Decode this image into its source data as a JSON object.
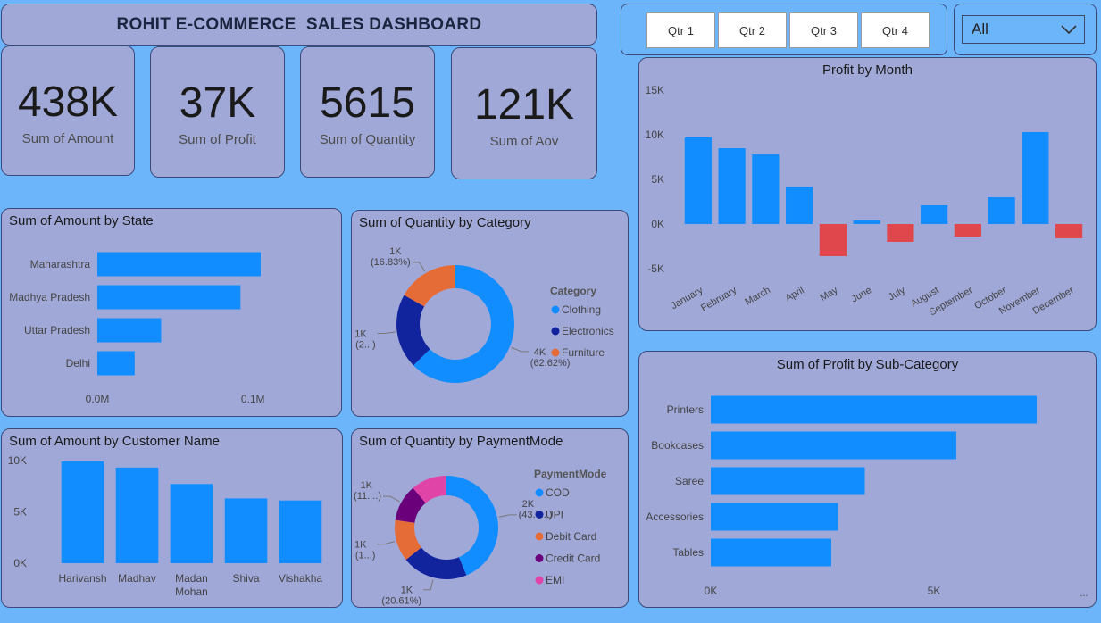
{
  "header": {
    "title": "ROHIT E-COMMERCE  SALES DASHBOARD"
  },
  "kpis": [
    {
      "value": "438K",
      "label": "Sum of Amount"
    },
    {
      "value": "37K",
      "label": "Sum of Profit"
    },
    {
      "value": "5615",
      "label": "Sum of Quantity"
    },
    {
      "value": "121K",
      "label": "Sum of Aov"
    }
  ],
  "quarter_slicer": [
    "Qtr 1",
    "Qtr 2",
    "Qtr 3",
    "Qtr 4"
  ],
  "dropdown": {
    "selected": "All"
  },
  "colors": {
    "positive": "#118dff",
    "negative": "#e0474c",
    "card": "#a0a8d8",
    "background": "#6db5fb"
  },
  "chart_data": [
    {
      "id": "amount_by_state",
      "type": "bar",
      "orientation": "horizontal",
      "title": "Sum of Amount by State",
      "categories": [
        "Maharashtra",
        "Madhya Pradesh",
        "Uttar Pradesh",
        "Delhi"
      ],
      "values": [
        105000,
        92000,
        41000,
        24000
      ],
      "xlim": [
        0,
        112500
      ],
      "xticks": [
        {
          "value": 0,
          "label": "0.0M"
        },
        {
          "value": 100000,
          "label": "0.1M"
        }
      ]
    },
    {
      "id": "quantity_by_category",
      "type": "pie",
      "donut": true,
      "title": "Sum of Quantity by Category",
      "legend_title": "Category",
      "labels": [
        "Clothing",
        "Electronics",
        "Furniture"
      ],
      "values": [
        62.62,
        20.55,
        16.83
      ],
      "colors": [
        "#118dff",
        "#12239e",
        "#e66c37"
      ],
      "data_labels": [
        [
          "4K",
          "(62.62%)"
        ],
        [
          "1K",
          "(2...)"
        ],
        [
          "1K",
          "(16.83%)"
        ]
      ]
    },
    {
      "id": "amount_by_customer",
      "type": "bar",
      "title": "Sum of Amount by Customer Name",
      "categories": [
        "Harivansh",
        "Madhav",
        "Madan Mohan",
        "Shiva",
        "Vishakha"
      ],
      "values": [
        9900,
        9300,
        7700,
        6300,
        6100
      ],
      "ylim": [
        0,
        10500
      ],
      "yticks": [
        {
          "value": 0,
          "label": "0K"
        },
        {
          "value": 5000,
          "label": "5K"
        },
        {
          "value": 10000,
          "label": "10K"
        }
      ]
    },
    {
      "id": "quantity_by_paymentmode",
      "type": "pie",
      "donut": true,
      "title": "Sum of Quantity by PaymentMode",
      "legend_title": "PaymentMode",
      "labels": [
        "COD",
        "UPI",
        "Debit Card",
        "Credit Card",
        "EMI"
      ],
      "values": [
        43.7,
        20.61,
        13.0,
        11.5,
        11.19
      ],
      "colors": [
        "#118dff",
        "#12239e",
        "#e66c37",
        "#6b007b",
        "#e044a7"
      ],
      "data_labels": [
        [
          "2K",
          "(43.7...)"
        ],
        [
          "1K",
          "(20.61%)"
        ],
        [
          "1K",
          "(1...)"
        ],
        [
          "1K",
          "(11....)"
        ],
        []
      ]
    },
    {
      "id": "profit_by_month",
      "type": "bar",
      "title": "Profit by Month",
      "categories": [
        "January",
        "February",
        "March",
        "April",
        "May",
        "June",
        "July",
        "August",
        "September",
        "October",
        "November",
        "December"
      ],
      "values": [
        9700,
        8500,
        7800,
        4200,
        -3600,
        400,
        -2000,
        2100,
        -1400,
        3000,
        10300,
        -1600
      ],
      "ylim": [
        -6000,
        15500
      ],
      "yticks": [
        {
          "value": -5000,
          "label": "-5K"
        },
        {
          "value": 0,
          "label": "0K"
        },
        {
          "value": 5000,
          "label": "5K"
        },
        {
          "value": 10000,
          "label": "10K"
        },
        {
          "value": 15000,
          "label": "15K"
        }
      ]
    },
    {
      "id": "profit_by_subcategory",
      "type": "bar",
      "orientation": "horizontal",
      "title": "Sum of Profit by Sub-Category",
      "categories": [
        "Printers",
        "Bookcases",
        "Saree",
        "Accessories",
        "Tables"
      ],
      "values": [
        7300,
        5500,
        3450,
        2850,
        2700
      ],
      "xlim": [
        0,
        8500
      ],
      "xticks": [
        {
          "value": 0,
          "label": "0K"
        },
        {
          "value": 5000,
          "label": "5K"
        }
      ],
      "more_indicator": "..."
    }
  ]
}
